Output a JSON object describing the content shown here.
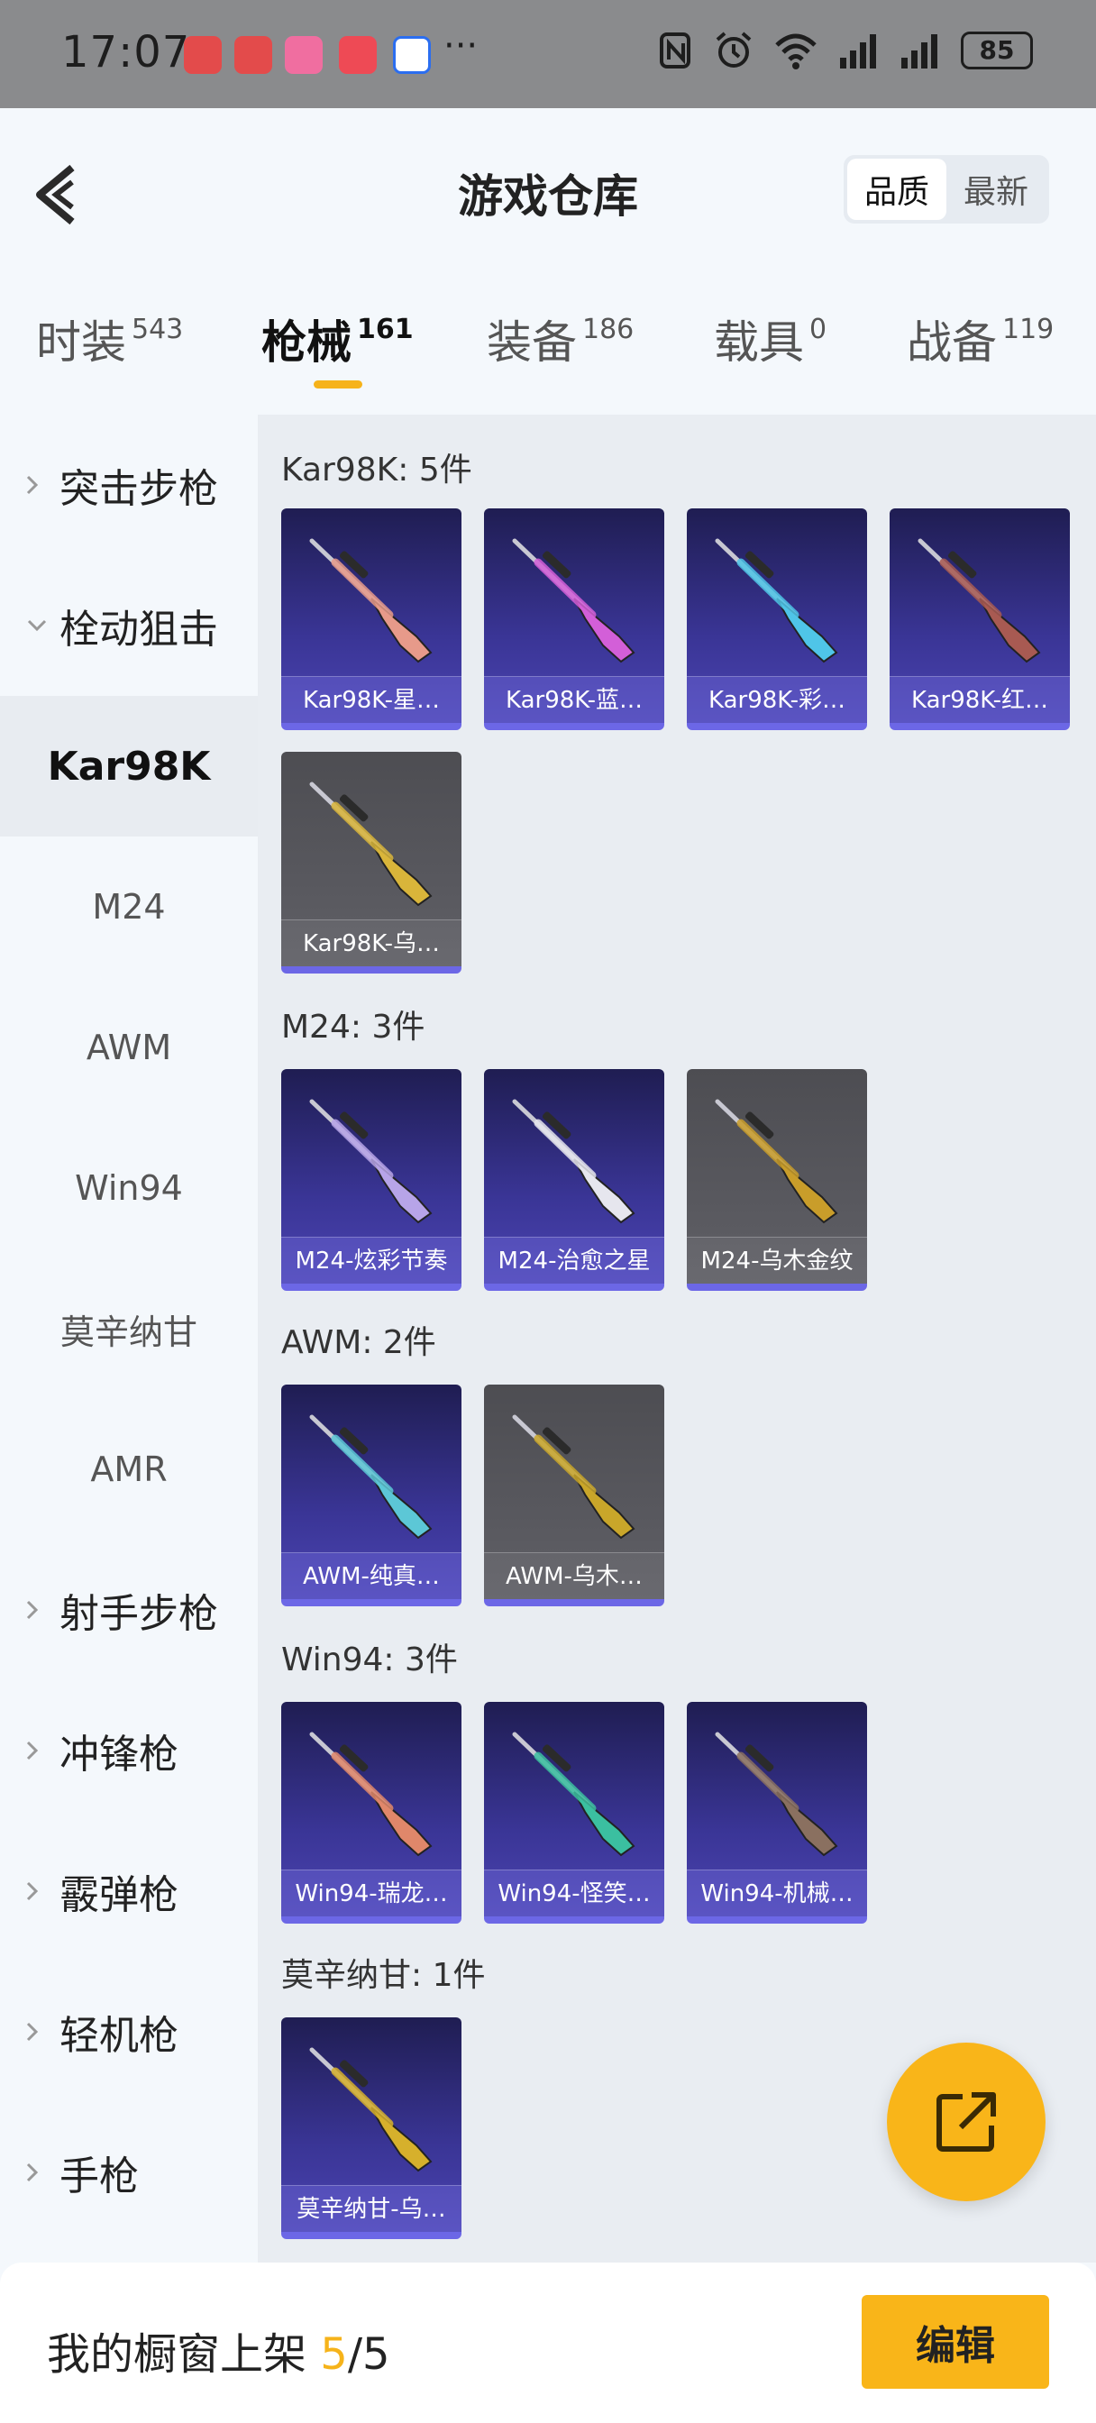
{
  "status_bar": {
    "time": "17:07",
    "battery": "85",
    "more": "···",
    "apps": [
      "app-red-1",
      "app-red-2",
      "bilibili",
      "app-red-3",
      "app-blue"
    ]
  },
  "header": {
    "title": "游戏仓库",
    "sort_options": [
      "品质",
      "最新"
    ],
    "active_sort": "品质"
  },
  "tabs": [
    {
      "label": "时装",
      "count": "543"
    },
    {
      "label": "枪械",
      "count": "161",
      "active": true
    },
    {
      "label": "装备",
      "count": "186"
    },
    {
      "label": "载具",
      "count": "0"
    },
    {
      "label": "战备",
      "count": "119"
    }
  ],
  "sidebar": {
    "items": [
      {
        "label": "突击步枪",
        "type": "parent",
        "expanded": false
      },
      {
        "label": "栓动狙击",
        "type": "parent",
        "expanded": true
      },
      {
        "label": "Kar98K",
        "type": "sub",
        "active": true
      },
      {
        "label": "M24",
        "type": "sub"
      },
      {
        "label": "AWM",
        "type": "sub"
      },
      {
        "label": "Win94",
        "type": "sub"
      },
      {
        "label": "莫辛纳甘",
        "type": "sub"
      },
      {
        "label": "AMR",
        "type": "sub"
      },
      {
        "label": "射手步枪",
        "type": "parent",
        "expanded": false
      },
      {
        "label": "冲锋枪",
        "type": "parent",
        "expanded": false
      },
      {
        "label": "霰弹枪",
        "type": "parent",
        "expanded": false
      },
      {
        "label": "轻机枪",
        "type": "parent",
        "expanded": false
      },
      {
        "label": "手枪",
        "type": "parent",
        "expanded": false
      }
    ]
  },
  "groups": [
    {
      "title": "Kar98K: 5件",
      "items": [
        {
          "label": "Kar98K-星…",
          "color": "#e79a8a",
          "tier": "purple"
        },
        {
          "label": "Kar98K-蓝…",
          "color": "#d35fd8",
          "tier": "purple"
        },
        {
          "label": "Kar98K-彩…",
          "color": "#4fc5e8",
          "tier": "purple"
        },
        {
          "label": "Kar98K-红…",
          "color": "#a85a52",
          "tier": "purple"
        },
        {
          "label": "Kar98K-乌…",
          "color": "#d9b53a",
          "tier": "grey"
        }
      ]
    },
    {
      "title": "M24: 3件",
      "items": [
        {
          "label": "M24-炫彩节奏",
          "color": "#b7a4e8",
          "tier": "purple"
        },
        {
          "label": "M24-治愈之星",
          "color": "#e6e6ee",
          "tier": "purple"
        },
        {
          "label": "M24-乌木金纹",
          "color": "#c99d2a",
          "tier": "grey"
        }
      ]
    },
    {
      "title": "AWM: 2件",
      "items": [
        {
          "label": "AWM-纯真…",
          "color": "#5cc7d6",
          "tier": "purple"
        },
        {
          "label": "AWM-乌木…",
          "color": "#c9a62a",
          "tier": "grey"
        }
      ]
    },
    {
      "title": "Win94: 3件",
      "items": [
        {
          "label": "Win94-瑞龙…",
          "color": "#e0876a",
          "tier": "purple"
        },
        {
          "label": "Win94-怪笑…",
          "color": "#3bbfa0",
          "tier": "purple"
        },
        {
          "label": "Win94-机械…",
          "color": "#8a7060",
          "tier": "purple"
        }
      ]
    },
    {
      "title": "莫辛纳甘: 1件",
      "items": [
        {
          "label": "莫辛纳甘-乌…",
          "color": "#d6b02c",
          "tier": "purple"
        }
      ]
    }
  ],
  "footer": {
    "prefix": "我的橱窗上架 ",
    "current": "5",
    "total": "/5",
    "edit_label": "编辑"
  },
  "colors": {
    "accent": "#f9b519",
    "card_purple": "#3a3596",
    "card_grey": "#58585e",
    "card_border": "#6c67e6"
  }
}
